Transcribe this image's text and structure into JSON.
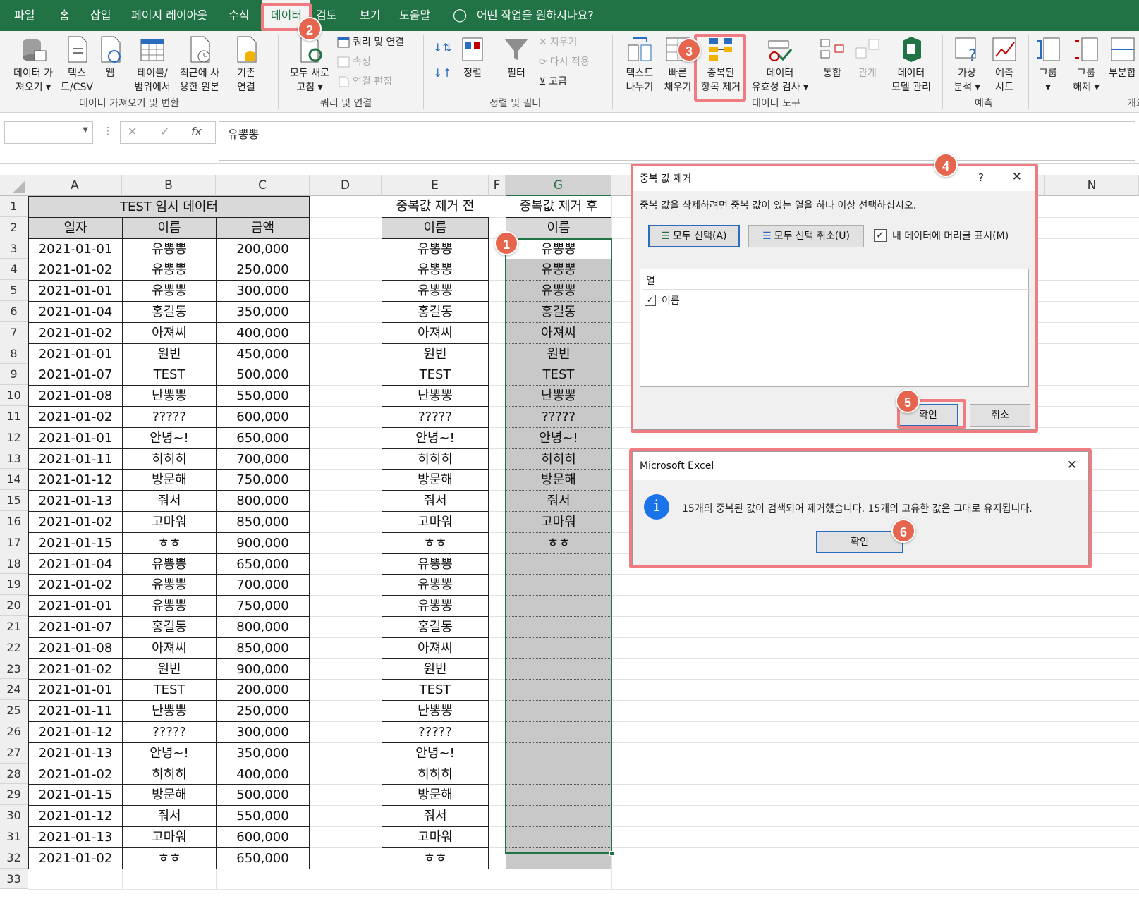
{
  "ribbon_tabs": [
    "파일",
    "홈",
    "삽입",
    "페이지 레이아웃",
    "수식",
    "데이터",
    "검토",
    "보기",
    "도움말"
  ],
  "tell_me": "어떤 작업을 원하시나요?",
  "ribbon": {
    "get_data": {
      "line1": "데이터 가",
      "line2": "져오기 ▾"
    },
    "text_csv": {
      "line1": "텍스",
      "line2": "트/CSV"
    },
    "web": "웹",
    "table_range": {
      "line1": "테이블/",
      "line2": "범위에서"
    },
    "recent_sources": {
      "line1": "최근에 사",
      "line2": "용한 원본"
    },
    "existing_conn": {
      "line1": "기존",
      "line2": "연결"
    },
    "refresh_all": {
      "line1": "모두 새로",
      "line2": "고침 ▾"
    },
    "queries_conn": "쿼리 및 연결",
    "properties": "속성",
    "edit_links": "연결 편집",
    "sort": "정렬",
    "filter": "필터",
    "clear": "지우기",
    "reapply": "다시 적용",
    "advanced": "고급",
    "text_to_cols": {
      "line1": "텍스트",
      "line2": "나누기"
    },
    "flash_fill": {
      "line1": "빠른",
      "line2": "채우기"
    },
    "remove_dup": {
      "line1": "중복된",
      "line2": "항목 제거"
    },
    "data_validation": {
      "line1": "데이터",
      "line2": "유효성 검사 ▾"
    },
    "consolidate": "통합",
    "relationships": "관계",
    "data_model": {
      "line1": "데이터",
      "line2": "모델 관리"
    },
    "whatif": {
      "line1": "가상",
      "line2": "분석 ▾"
    },
    "forecast_sheet": {
      "line1": "예측",
      "line2": "시트"
    },
    "group": {
      "line1": "그룹",
      "line2": "▾"
    },
    "ungroup": {
      "line1": "그룹",
      "line2": "해제 ▾"
    },
    "subtotal": "부분합",
    "groups": {
      "get_transform": "데이터 가져오기 및 변환",
      "queries": "쿼리 및 연결",
      "sort_filter": "정렬 및 필터",
      "data_tools": "데이터 도구",
      "forecast": "예측",
      "outline": "개요"
    }
  },
  "formula_bar": {
    "namebox": "",
    "fx": "fx",
    "content": "유뽕뽕"
  },
  "columns": [
    "A",
    "B",
    "C",
    "D",
    "E",
    "F",
    "G",
    "N"
  ],
  "rows": [
    "1",
    "2",
    "3",
    "4",
    "5",
    "6",
    "7",
    "8",
    "9",
    "10",
    "11",
    "12",
    "13",
    "14",
    "15",
    "16",
    "17",
    "18",
    "19",
    "20",
    "21",
    "22",
    "23",
    "24",
    "25",
    "26",
    "27",
    "28",
    "29",
    "30",
    "31",
    "32",
    "33"
  ],
  "sheet": {
    "title_a": "TEST 임시 데이터",
    "hdr_date": "일자",
    "hdr_name": "이름",
    "hdr_amount": "금액",
    "title_e": "중복값 제거 전",
    "title_g": "중복값 제거 후",
    "hdr_e": "이름",
    "hdr_g": "이름",
    "dates": [
      "2021-01-01",
      "2021-01-02",
      "2021-01-01",
      "2021-01-04",
      "2021-01-02",
      "2021-01-01",
      "2021-01-07",
      "2021-01-08",
      "2021-01-02",
      "2021-01-01",
      "2021-01-11",
      "2021-01-12",
      "2021-01-13",
      "2021-01-02",
      "2021-01-15",
      "2021-01-04",
      "2021-01-02",
      "2021-01-01",
      "2021-01-07",
      "2021-01-08",
      "2021-01-02",
      "2021-01-01",
      "2021-01-11",
      "2021-01-12",
      "2021-01-13",
      "2021-01-02",
      "2021-01-15",
      "2021-01-12",
      "2021-01-13",
      "2021-01-02"
    ],
    "names": [
      "유뽕뽕",
      "유뽕뽕",
      "유뽕뽕",
      "홍길동",
      "아져씨",
      "원빈",
      "TEST",
      "난뽕뽕",
      "?????",
      "안녕~!",
      "히히히",
      "방문해",
      "줘서",
      "고마워",
      "ㅎㅎ",
      "유뽕뽕",
      "유뽕뽕",
      "유뽕뽕",
      "홍길동",
      "아져씨",
      "원빈",
      "TEST",
      "난뽕뽕",
      "?????",
      "안녕~!",
      "히히히",
      "방문해",
      "줘서",
      "고마워",
      "ㅎㅎ"
    ],
    "amounts": [
      "200,000",
      "250,000",
      "300,000",
      "350,000",
      "400,000",
      "450,000",
      "500,000",
      "550,000",
      "600,000",
      "650,000",
      "700,000",
      "750,000",
      "800,000",
      "850,000",
      "900,000",
      "650,000",
      "700,000",
      "750,000",
      "800,000",
      "850,000",
      "900,000",
      "200,000",
      "250,000",
      "300,000",
      "350,000",
      "400,000",
      "500,000",
      "550,000",
      "600,000",
      "650,000"
    ],
    "names_before": [
      "유뽕뽕",
      "유뽕뽕",
      "유뽕뽕",
      "홍길동",
      "아져씨",
      "원빈",
      "TEST",
      "난뽕뽕",
      "?????",
      "안녕~!",
      "히히히",
      "방문해",
      "줘서",
      "고마워",
      "ㅎㅎ",
      "유뽕뽕",
      "유뽕뽕",
      "유뽕뽕",
      "홍길동",
      "아져씨",
      "원빈",
      "TEST",
      "난뽕뽕",
      "?????",
      "안녕~!",
      "히히히",
      "방문해",
      "줘서",
      "고마워",
      "ㅎㅎ"
    ],
    "names_after": [
      "유뽕뽕",
      "유뽕뽕",
      "유뽕뽕",
      "홍길동",
      "아져씨",
      "원빈",
      "TEST",
      "난뽕뽕",
      "?????",
      "안녕~!",
      "히히히",
      "방문해",
      "줘서",
      "고마워",
      "ㅎㅎ"
    ]
  },
  "dup_dialog": {
    "title": "중복 값 제거",
    "help": "?",
    "close": "✕",
    "instruction": "중복 값을 삭제하려면 중복 값이 있는 열을 하나 이상 선택하십시오.",
    "select_all": "모두 선택(A)",
    "unselect_all": "모두 선택 취소(U)",
    "has_headers": "내 데이터에 머리글 표시(M)",
    "col_header": "열",
    "column_item": "이름",
    "ok": "확인",
    "cancel": "취소"
  },
  "msg_dialog": {
    "title": "Microsoft Excel",
    "close": "✕",
    "message": "15개의 중복된 값이 검색되어 제거했습니다. 15개의 고유한 값은 그대로 유지됩니다.",
    "ok": "확인"
  },
  "badges": [
    "1",
    "2",
    "3",
    "4",
    "5",
    "6"
  ],
  "colors": {
    "excel_green": "#217346",
    "highlight": "#f07b80",
    "badge": "#e5654e",
    "info_blue": "#1a73e8"
  }
}
